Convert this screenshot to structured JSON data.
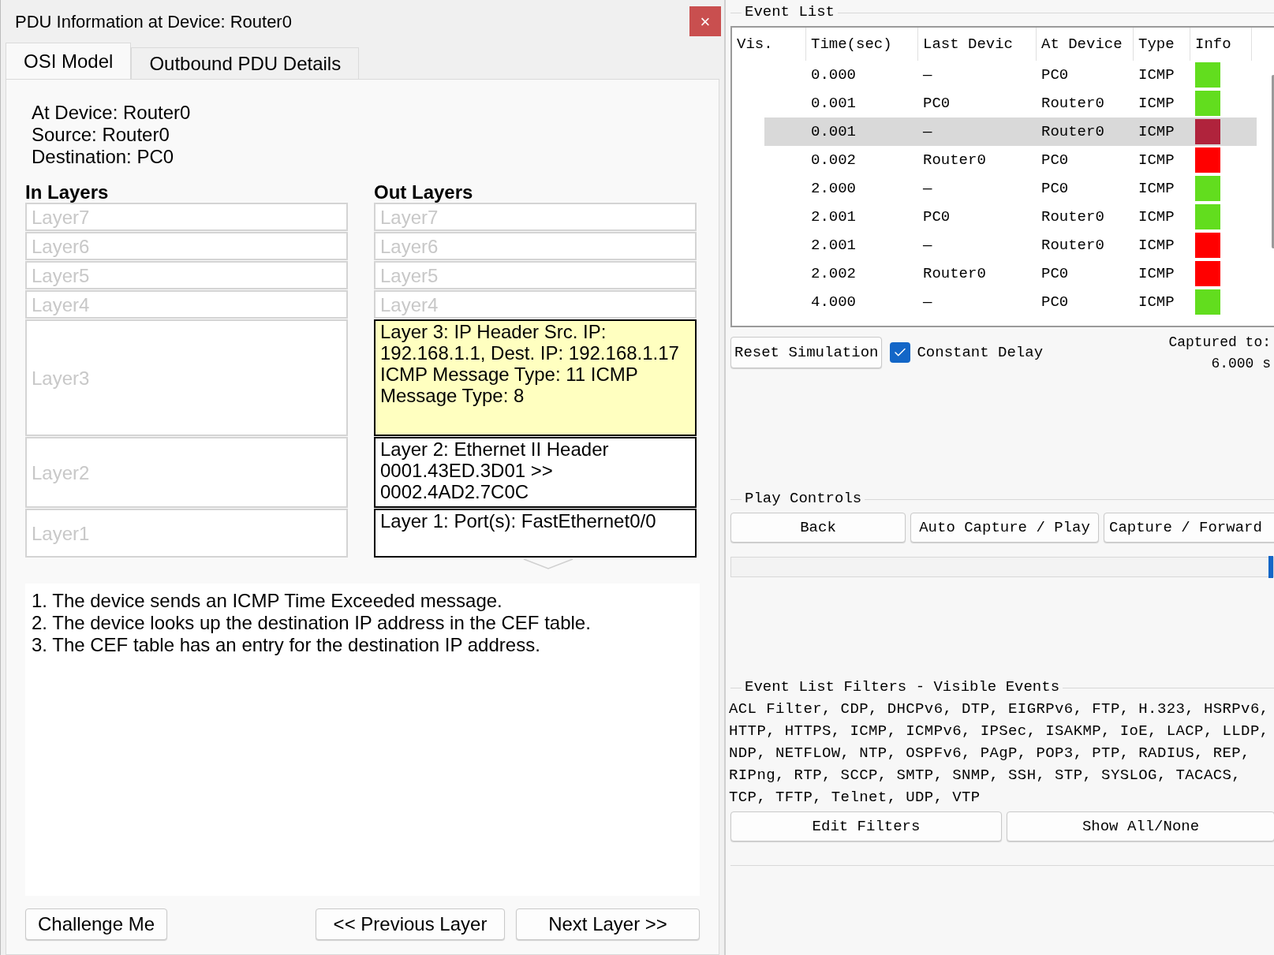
{
  "dialog": {
    "title": "PDU Information at Device: Router0",
    "close": "×",
    "tabs": [
      {
        "label": "OSI Model",
        "selected": true
      },
      {
        "label": "Outbound PDU Details",
        "selected": false
      }
    ],
    "info": [
      "At Device: Router0",
      "Source: Router0",
      "Destination: PC0"
    ],
    "in_layers": {
      "heading": "In Layers",
      "layers": [
        {
          "label": "Layer7",
          "active": false,
          "selected": false
        },
        {
          "label": "Layer6",
          "active": false,
          "selected": false
        },
        {
          "label": "Layer5",
          "active": false,
          "selected": false
        },
        {
          "label": "Layer4",
          "active": false,
          "selected": false
        },
        {
          "label": "Layer3",
          "active": false,
          "selected": false
        },
        {
          "label": "Layer2",
          "active": false,
          "selected": false
        },
        {
          "label": "Layer1",
          "active": false,
          "selected": false
        }
      ]
    },
    "out_layers": {
      "heading": "Out Layers",
      "layers": [
        {
          "label": "Layer7",
          "active": false,
          "selected": false
        },
        {
          "label": "Layer6",
          "active": false,
          "selected": false
        },
        {
          "label": "Layer5",
          "active": false,
          "selected": false
        },
        {
          "label": "Layer4",
          "active": false,
          "selected": false
        },
        {
          "label": "Layer 3: IP Header Src. IP: 192.168.1.1, Dest. IP: 192.168.1.17 ICMP Message Type: 11 ICMP Message Type: 8",
          "active": true,
          "selected": true
        },
        {
          "label": "Layer 2: Ethernet II Header 0001.43ED.3D01 >> 0002.4AD2.7C0C",
          "active": true,
          "selected": false
        },
        {
          "label": "Layer 1: Port(s): FastEthernet0/0",
          "active": true,
          "selected": false
        }
      ]
    },
    "explanation": [
      "1. The device sends an ICMP Time Exceeded message.",
      "2. The device looks up the destination IP address in the CEF table.",
      "3. The CEF table has an entry for the destination IP address."
    ],
    "buttons": [
      "Challenge Me",
      "<< Previous Layer",
      "Next Layer >>"
    ]
  },
  "event_list": {
    "title": "Event List",
    "columns": [
      "Vis.",
      "Time(sec)",
      "Last Devic",
      "At Device",
      "Type",
      "Info"
    ],
    "rows": [
      {
        "time": "0.000",
        "last_device": "—",
        "at_device": "PC0",
        "type": "ICMP",
        "color": "#62dd1e",
        "selected": false
      },
      {
        "time": "0.001",
        "last_device": "PC0",
        "at_device": "Router0",
        "type": "ICMP",
        "color": "#62dd1e",
        "selected": false
      },
      {
        "time": "0.001",
        "last_device": "—",
        "at_device": "Router0",
        "type": "ICMP",
        "color": "#b0233c",
        "selected": true
      },
      {
        "time": "0.002",
        "last_device": "Router0",
        "at_device": "PC0",
        "type": "ICMP",
        "color": "#ff0000",
        "selected": false
      },
      {
        "time": "2.000",
        "last_device": "—",
        "at_device": "PC0",
        "type": "ICMP",
        "color": "#62dd1e",
        "selected": false
      },
      {
        "time": "2.001",
        "last_device": "PC0",
        "at_device": "Router0",
        "type": "ICMP",
        "color": "#62dd1e",
        "selected": false
      },
      {
        "time": "2.001",
        "last_device": "—",
        "at_device": "Router0",
        "type": "ICMP",
        "color": "#ff0000",
        "selected": false
      },
      {
        "time": "2.002",
        "last_device": "Router0",
        "at_device": "PC0",
        "type": "ICMP",
        "color": "#ff0000",
        "selected": false
      },
      {
        "time": "4.000",
        "last_device": "—",
        "at_device": "PC0",
        "type": "ICMP",
        "color": "#62dd1e",
        "selected": false
      }
    ]
  },
  "reset_button": "Reset Simulation",
  "constant_delay": {
    "label": "Constant Delay",
    "checked": true
  },
  "captured": [
    "Captured to:",
    "6.000 s"
  ],
  "play_controls": {
    "title": "Play Controls",
    "buttons": [
      "Back",
      "Auto Capture / Play",
      "Capture / Forward"
    ],
    "level": 1
  },
  "filters": {
    "title": "Event List Filters - Visible Events",
    "lines": [
      "ACL Filter, CDP, DHCPv6, DTP, EIGRPv6, FTP, H.323, HSRPv6,",
      "HTTP, HTTPS, ICMP, ICMPv6, IPSec, ISAKMP, IoE, LACP, LLDP,",
      "NDP, NETFLOW, NTP, OSPFv6, PAgP, POP3, PTP, RADIUS, REP,",
      "RIPng, RTP, SCCP, SMTP, SNMP, SSH, STP, SYSLOG, TACACS,",
      "TCP, TFTP, Telnet, UDP, VTP"
    ],
    "buttons": [
      "Edit Filters",
      "Show All/None"
    ]
  }
}
